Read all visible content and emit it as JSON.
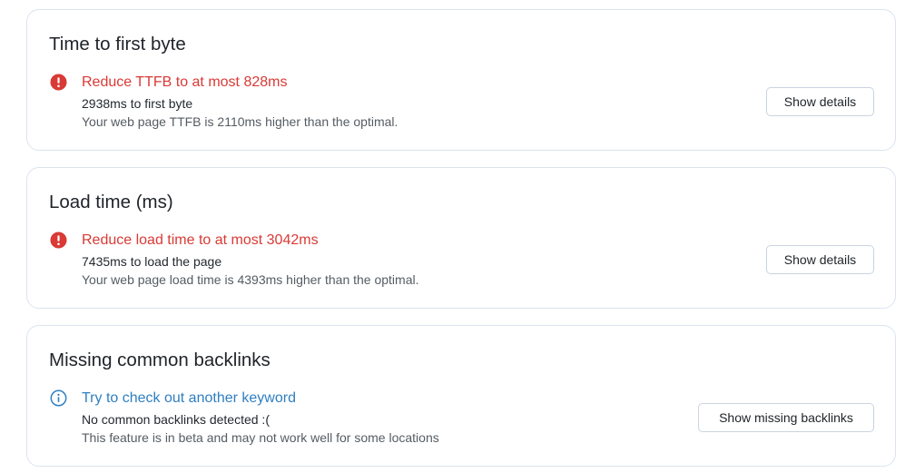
{
  "cards": [
    {
      "title": "Time to first byte",
      "status": "error",
      "icon": "error-icon",
      "headline": "Reduce TTFB to at most 828ms",
      "subline": "2938ms to first byte",
      "detail": "Your web page TTFB is 2110ms higher than the optimal.",
      "button_label": "Show details"
    },
    {
      "title": "Load time (ms)",
      "status": "error",
      "icon": "error-icon",
      "headline": "Reduce load time to at most 3042ms",
      "subline": "7435ms to load the page",
      "detail": "Your web page load time is 4393ms higher than the optimal.",
      "button_label": "Show details"
    },
    {
      "title": "Missing common backlinks",
      "status": "info",
      "icon": "info-icon",
      "headline": "Try to check out another keyword",
      "subline": "No common backlinks detected :(",
      "detail": "This feature is in beta and may not work well for some locations",
      "button_label": "Show missing backlinks"
    }
  ],
  "colors": {
    "error": "#d93a35",
    "info": "#2f7fc1",
    "card_border": "#dbe3ee",
    "button_border": "#c9d3df"
  }
}
